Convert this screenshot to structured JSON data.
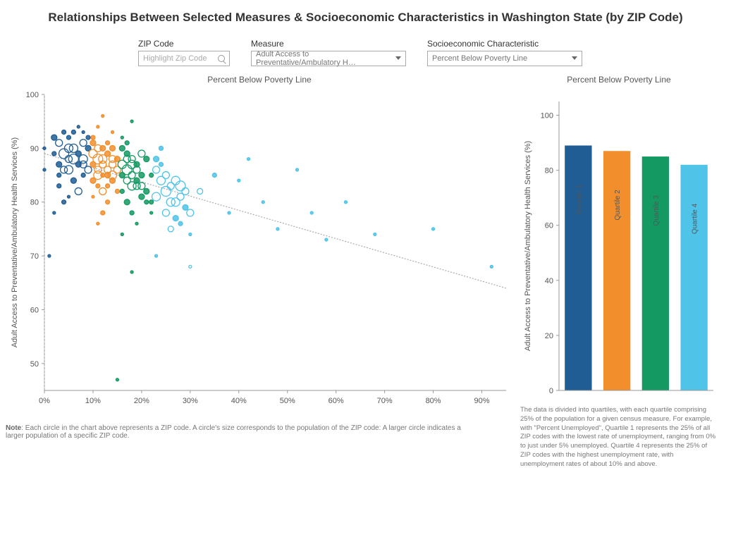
{
  "title": "Relationships Between Selected Measures & Socioeconomic Characteristics in Washington State (by ZIP Code)",
  "controls": {
    "zip_label": "ZIP Code",
    "zip_placeholder": "Highlight Zip Code",
    "measure_label": "Measure",
    "measure_value": "Adult Access to Preventative/Ambulatory H…",
    "socio_label": "Socioeconomic Characteristic",
    "socio_value": "Percent Below Poverty Line"
  },
  "scatter_title": "Percent Below Poverty Line",
  "bar_title": "Percent Below Poverty Line",
  "y_axis_label": "Adult Access to Preventative/Ambulatory Health Services (%)",
  "note_prefix": "Note",
  "note_body": ": Each circle in the chart above represents a ZIP code. A circle's size corresponds to the population of the ZIP code: A larger circle indicates a larger population of a specific ZIP code.",
  "bar_desc": "The data is divided into quartiles, with each quartile comprising 25% of the population for a given census measure. For example, with \"Percent Unemployed\", Quartile 1 represents the 25% of all ZIP codes with the lowest rate of unemployment, ranging from 0% to just under 5% unemployed. Quartile 4 represents the 25% of ZIP codes with the highest unemployment rate, with unemployment rates of about 10% and above.",
  "colors": {
    "q1": "#1f5d94",
    "q2": "#f28e2b",
    "q3": "#159962",
    "q4": "#4fc3e8"
  },
  "chart_data": [
    {
      "type": "scatter",
      "title": "Percent Below Poverty Line",
      "xlabel": "Percent Below Poverty Line",
      "ylabel": "Adult Access to Preventative/Ambulatory Health Services (%)",
      "xlim": [
        0,
        95
      ],
      "ylim": [
        45,
        100
      ],
      "x_ticks": [
        "0%",
        "10%",
        "20%",
        "30%",
        "40%",
        "50%",
        "60%",
        "70%",
        "80%",
        "90%"
      ],
      "y_ticks": [
        50,
        60,
        70,
        80,
        90,
        100
      ],
      "trend_line": {
        "x1": 0,
        "y1": 89,
        "x2": 95,
        "y2": 64
      },
      "series": [
        {
          "name": "Quartile 1",
          "color": "#1f5d94",
          "points": [
            {
              "x": 2,
              "y": 92,
              "r": 4,
              "f": 1
            },
            {
              "x": 3,
              "y": 91,
              "r": 5,
              "f": 0
            },
            {
              "x": 4,
              "y": 93,
              "r": 3,
              "f": 1
            },
            {
              "x": 5,
              "y": 90,
              "r": 6,
              "f": 0
            },
            {
              "x": 6,
              "y": 88,
              "r": 7,
              "f": 0
            },
            {
              "x": 7,
              "y": 89,
              "r": 4,
              "f": 1
            },
            {
              "x": 8,
              "y": 87,
              "r": 5,
              "f": 0
            },
            {
              "x": 5,
              "y": 86,
              "r": 6,
              "f": 0
            },
            {
              "x": 3,
              "y": 85,
              "r": 3,
              "f": 1
            },
            {
              "x": 6,
              "y": 84,
              "r": 4,
              "f": 1
            },
            {
              "x": 7,
              "y": 82,
              "r": 5,
              "f": 0
            },
            {
              "x": 4,
              "y": 80,
              "r": 3,
              "f": 1
            },
            {
              "x": 2,
              "y": 78,
              "r": 2,
              "f": 1
            },
            {
              "x": 1,
              "y": 70,
              "r": 2,
              "f": 1
            },
            {
              "x": 8,
              "y": 91,
              "r": 5,
              "f": 0
            },
            {
              "x": 9,
              "y": 90,
              "r": 4,
              "f": 1
            },
            {
              "x": 5,
              "y": 92,
              "r": 3,
              "f": 1
            },
            {
              "x": 6,
              "y": 93,
              "r": 3,
              "f": 1
            },
            {
              "x": 7,
              "y": 94,
              "r": 2,
              "f": 1
            },
            {
              "x": 4,
              "y": 89,
              "r": 7,
              "f": 0
            },
            {
              "x": 8,
              "y": 88,
              "r": 6,
              "f": 0
            },
            {
              "x": 9,
              "y": 86,
              "r": 5,
              "f": 0
            },
            {
              "x": 3,
              "y": 87,
              "r": 4,
              "f": 1
            },
            {
              "x": 2,
              "y": 89,
              "r": 3,
              "f": 1
            },
            {
              "x": 5,
              "y": 88,
              "r": 5,
              "f": 0
            },
            {
              "x": 6,
              "y": 90,
              "r": 6,
              "f": 0
            },
            {
              "x": 7,
              "y": 87,
              "r": 4,
              "f": 1
            },
            {
              "x": 8,
              "y": 85,
              "r": 3,
              "f": 1
            },
            {
              "x": 4,
              "y": 86,
              "r": 5,
              "f": 0
            },
            {
              "x": 3,
              "y": 83,
              "r": 3,
              "f": 1
            },
            {
              "x": 5,
              "y": 81,
              "r": 2,
              "f": 1
            },
            {
              "x": 0,
              "y": 86,
              "r": 2,
              "f": 1
            },
            {
              "x": 0,
              "y": 90,
              "r": 2,
              "f": 1
            },
            {
              "x": 9,
              "y": 92,
              "r": 3,
              "f": 1
            },
            {
              "x": 8,
              "y": 93,
              "r": 2,
              "f": 1
            }
          ]
        },
        {
          "name": "Quartile 2",
          "color": "#f28e2b",
          "points": [
            {
              "x": 10,
              "y": 91,
              "r": 4,
              "f": 1
            },
            {
              "x": 11,
              "y": 90,
              "r": 5,
              "f": 0
            },
            {
              "x": 12,
              "y": 88,
              "r": 6,
              "f": 0
            },
            {
              "x": 10,
              "y": 87,
              "r": 4,
              "f": 1
            },
            {
              "x": 11,
              "y": 86,
              "r": 5,
              "f": 0
            },
            {
              "x": 12,
              "y": 85,
              "r": 3,
              "f": 1
            },
            {
              "x": 13,
              "y": 89,
              "r": 4,
              "f": 1
            },
            {
              "x": 14,
              "y": 87,
              "r": 5,
              "f": 0
            },
            {
              "x": 10,
              "y": 84,
              "r": 4,
              "f": 1
            },
            {
              "x": 11,
              "y": 83,
              "r": 3,
              "f": 1
            },
            {
              "x": 12,
              "y": 82,
              "r": 5,
              "f": 0
            },
            {
              "x": 13,
              "y": 80,
              "r": 3,
              "f": 1
            },
            {
              "x": 14,
              "y": 85,
              "r": 6,
              "f": 0
            },
            {
              "x": 15,
              "y": 88,
              "r": 4,
              "f": 1
            },
            {
              "x": 10,
              "y": 92,
              "r": 3,
              "f": 1
            },
            {
              "x": 11,
              "y": 94,
              "r": 2,
              "f": 1
            },
            {
              "x": 12,
              "y": 96,
              "r": 2,
              "f": 1
            },
            {
              "x": 13,
              "y": 86,
              "r": 5,
              "f": 0
            },
            {
              "x": 14,
              "y": 84,
              "r": 4,
              "f": 1
            },
            {
              "x": 15,
              "y": 82,
              "r": 3,
              "f": 1
            },
            {
              "x": 10,
              "y": 89,
              "r": 6,
              "f": 0
            },
            {
              "x": 11,
              "y": 88,
              "r": 7,
              "f": 0
            },
            {
              "x": 12,
              "y": 87,
              "r": 5,
              "f": 0
            },
            {
              "x": 13,
              "y": 83,
              "r": 3,
              "f": 1
            },
            {
              "x": 14,
              "y": 90,
              "r": 4,
              "f": 1
            },
            {
              "x": 15,
              "y": 86,
              "r": 5,
              "f": 0
            },
            {
              "x": 10,
              "y": 81,
              "r": 2,
              "f": 1
            },
            {
              "x": 11,
              "y": 76,
              "r": 2,
              "f": 1
            },
            {
              "x": 12,
              "y": 78,
              "r": 3,
              "f": 1
            },
            {
              "x": 13,
              "y": 91,
              "r": 3,
              "f": 1
            },
            {
              "x": 14,
              "y": 93,
              "r": 2,
              "f": 1
            },
            {
              "x": 11,
              "y": 85,
              "r": 6,
              "f": 0
            },
            {
              "x": 12,
              "y": 90,
              "r": 4,
              "f": 1
            },
            {
              "x": 13,
              "y": 85,
              "r": 4,
              "f": 1
            },
            {
              "x": 14,
              "y": 88,
              "r": 5,
              "f": 0
            }
          ]
        },
        {
          "name": "Quartile 3",
          "color": "#159962",
          "points": [
            {
              "x": 16,
              "y": 90,
              "r": 4,
              "f": 1
            },
            {
              "x": 17,
              "y": 88,
              "r": 5,
              "f": 0
            },
            {
              "x": 18,
              "y": 87,
              "r": 6,
              "f": 0
            },
            {
              "x": 16,
              "y": 85,
              "r": 4,
              "f": 1
            },
            {
              "x": 17,
              "y": 84,
              "r": 5,
              "f": 0
            },
            {
              "x": 18,
              "y": 83,
              "r": 6,
              "f": 0
            },
            {
              "x": 19,
              "y": 86,
              "r": 5,
              "f": 0
            },
            {
              "x": 20,
              "y": 85,
              "r": 4,
              "f": 1
            },
            {
              "x": 16,
              "y": 82,
              "r": 3,
              "f": 1
            },
            {
              "x": 17,
              "y": 80,
              "r": 4,
              "f": 1
            },
            {
              "x": 18,
              "y": 78,
              "r": 3,
              "f": 1
            },
            {
              "x": 19,
              "y": 76,
              "r": 2,
              "f": 1
            },
            {
              "x": 20,
              "y": 89,
              "r": 5,
              "f": 0
            },
            {
              "x": 21,
              "y": 88,
              "r": 4,
              "f": 1
            },
            {
              "x": 22,
              "y": 85,
              "r": 3,
              "f": 1
            },
            {
              "x": 16,
              "y": 92,
              "r": 2,
              "f": 1
            },
            {
              "x": 17,
              "y": 91,
              "r": 3,
              "f": 1
            },
            {
              "x": 18,
              "y": 95,
              "r": 2,
              "f": 1
            },
            {
              "x": 19,
              "y": 83,
              "r": 5,
              "f": 0
            },
            {
              "x": 20,
              "y": 81,
              "r": 4,
              "f": 1
            },
            {
              "x": 21,
              "y": 80,
              "r": 3,
              "f": 1
            },
            {
              "x": 22,
              "y": 78,
              "r": 2,
              "f": 1
            },
            {
              "x": 16,
              "y": 87,
              "r": 6,
              "f": 0
            },
            {
              "x": 17,
              "y": 86,
              "r": 7,
              "f": 0
            },
            {
              "x": 18,
              "y": 85,
              "r": 5,
              "f": 0
            },
            {
              "x": 19,
              "y": 84,
              "r": 4,
              "f": 1
            },
            {
              "x": 20,
              "y": 83,
              "r": 5,
              "f": 0
            },
            {
              "x": 21,
              "y": 82,
              "r": 4,
              "f": 1
            },
            {
              "x": 22,
              "y": 80,
              "r": 3,
              "f": 1
            },
            {
              "x": 18,
              "y": 67,
              "r": 2,
              "f": 1
            },
            {
              "x": 15,
              "y": 47,
              "r": 2,
              "f": 1
            },
            {
              "x": 16,
              "y": 74,
              "r": 2,
              "f": 1
            },
            {
              "x": 17,
              "y": 89,
              "r": 4,
              "f": 1
            },
            {
              "x": 18,
              "y": 88,
              "r": 5,
              "f": 0
            },
            {
              "x": 19,
              "y": 87,
              "r": 4,
              "f": 1
            }
          ]
        },
        {
          "name": "Quartile 4",
          "color": "#4fc3e8",
          "points": [
            {
              "x": 23,
              "y": 86,
              "r": 5,
              "f": 0
            },
            {
              "x": 24,
              "y": 84,
              "r": 6,
              "f": 0
            },
            {
              "x": 25,
              "y": 82,
              "r": 7,
              "f": 0
            },
            {
              "x": 26,
              "y": 83,
              "r": 5,
              "f": 0
            },
            {
              "x": 27,
              "y": 80,
              "r": 6,
              "f": 0
            },
            {
              "x": 28,
              "y": 81,
              "r": 5,
              "f": 0
            },
            {
              "x": 29,
              "y": 79,
              "r": 4,
              "f": 1
            },
            {
              "x": 30,
              "y": 78,
              "r": 5,
              "f": 0
            },
            {
              "x": 23,
              "y": 88,
              "r": 4,
              "f": 1
            },
            {
              "x": 24,
              "y": 87,
              "r": 3,
              "f": 1
            },
            {
              "x": 25,
              "y": 85,
              "r": 5,
              "f": 0
            },
            {
              "x": 26,
              "y": 80,
              "r": 6,
              "f": 0
            },
            {
              "x": 27,
              "y": 77,
              "r": 4,
              "f": 1
            },
            {
              "x": 28,
              "y": 76,
              "r": 3,
              "f": 1
            },
            {
              "x": 30,
              "y": 74,
              "r": 2,
              "f": 1
            },
            {
              "x": 32,
              "y": 82,
              "r": 4,
              "f": 0
            },
            {
              "x": 35,
              "y": 85,
              "r": 3,
              "f": 1
            },
            {
              "x": 38,
              "y": 78,
              "r": 2,
              "f": 1
            },
            {
              "x": 40,
              "y": 84,
              "r": 2,
              "f": 1
            },
            {
              "x": 42,
              "y": 88,
              "r": 2,
              "f": 1
            },
            {
              "x": 45,
              "y": 80,
              "r": 2,
              "f": 1
            },
            {
              "x": 48,
              "y": 75,
              "r": 2,
              "f": 1
            },
            {
              "x": 52,
              "y": 86,
              "r": 2,
              "f": 1
            },
            {
              "x": 55,
              "y": 78,
              "r": 2,
              "f": 1
            },
            {
              "x": 58,
              "y": 73,
              "r": 2,
              "f": 1
            },
            {
              "x": 62,
              "y": 80,
              "r": 2,
              "f": 1
            },
            {
              "x": 68,
              "y": 74,
              "r": 2,
              "f": 1
            },
            {
              "x": 80,
              "y": 75,
              "r": 2,
              "f": 1
            },
            {
              "x": 92,
              "y": 68,
              "r": 2,
              "f": 1
            },
            {
              "x": 24,
              "y": 90,
              "r": 3,
              "f": 1
            },
            {
              "x": 25,
              "y": 78,
              "r": 5,
              "f": 0
            },
            {
              "x": 26,
              "y": 75,
              "r": 4,
              "f": 0
            },
            {
              "x": 27,
              "y": 84,
              "r": 6,
              "f": 0
            },
            {
              "x": 28,
              "y": 83,
              "r": 7,
              "f": 0
            },
            {
              "x": 29,
              "y": 82,
              "r": 5,
              "f": 0
            },
            {
              "x": 23,
              "y": 70,
              "r": 2,
              "f": 1
            },
            {
              "x": 23,
              "y": 81,
              "r": 6,
              "f": 0
            },
            {
              "x": 30,
              "y": 68,
              "r": 2,
              "f": 0
            }
          ]
        }
      ]
    },
    {
      "type": "bar",
      "title": "Percent Below Poverty Line",
      "ylabel": "Adult Access to Preventative/Ambulatory Health Services (%)",
      "ylim": [
        0,
        105
      ],
      "y_ticks": [
        0,
        20,
        40,
        60,
        80,
        100
      ],
      "categories": [
        "Quartile 1",
        "Quartile 2",
        "Quartile 3",
        "Quartile 4"
      ],
      "values": [
        89,
        87,
        85,
        82
      ],
      "colors": [
        "#1f5d94",
        "#f28e2b",
        "#159962",
        "#4fc3e8"
      ]
    }
  ]
}
